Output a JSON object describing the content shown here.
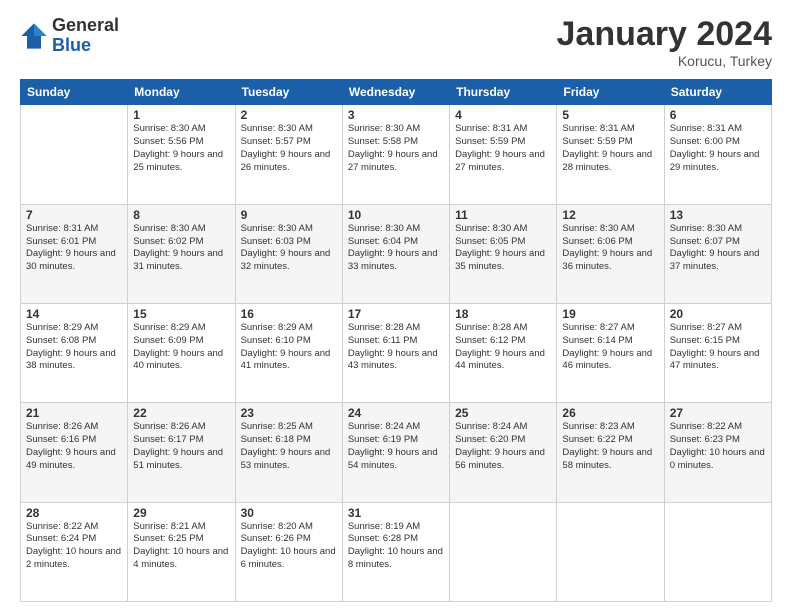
{
  "logo": {
    "general": "General",
    "blue": "Blue"
  },
  "title": {
    "month": "January 2024",
    "location": "Korucu, Turkey"
  },
  "weekdays": [
    "Sunday",
    "Monday",
    "Tuesday",
    "Wednesday",
    "Thursday",
    "Friday",
    "Saturday"
  ],
  "weeks": [
    [
      {
        "day": "",
        "empty": true
      },
      {
        "day": "1",
        "sunrise": "8:30 AM",
        "sunset": "5:56 PM",
        "daylight": "9 hours and 25 minutes."
      },
      {
        "day": "2",
        "sunrise": "8:30 AM",
        "sunset": "5:57 PM",
        "daylight": "9 hours and 26 minutes."
      },
      {
        "day": "3",
        "sunrise": "8:30 AM",
        "sunset": "5:58 PM",
        "daylight": "9 hours and 27 minutes."
      },
      {
        "day": "4",
        "sunrise": "8:31 AM",
        "sunset": "5:59 PM",
        "daylight": "9 hours and 27 minutes."
      },
      {
        "day": "5",
        "sunrise": "8:31 AM",
        "sunset": "5:59 PM",
        "daylight": "9 hours and 28 minutes."
      },
      {
        "day": "6",
        "sunrise": "8:31 AM",
        "sunset": "6:00 PM",
        "daylight": "9 hours and 29 minutes."
      }
    ],
    [
      {
        "day": "7",
        "sunrise": "8:31 AM",
        "sunset": "6:01 PM",
        "daylight": "9 hours and 30 minutes."
      },
      {
        "day": "8",
        "sunrise": "8:30 AM",
        "sunset": "6:02 PM",
        "daylight": "9 hours and 31 minutes."
      },
      {
        "day": "9",
        "sunrise": "8:30 AM",
        "sunset": "6:03 PM",
        "daylight": "9 hours and 32 minutes."
      },
      {
        "day": "10",
        "sunrise": "8:30 AM",
        "sunset": "6:04 PM",
        "daylight": "9 hours and 33 minutes."
      },
      {
        "day": "11",
        "sunrise": "8:30 AM",
        "sunset": "6:05 PM",
        "daylight": "9 hours and 35 minutes."
      },
      {
        "day": "12",
        "sunrise": "8:30 AM",
        "sunset": "6:06 PM",
        "daylight": "9 hours and 36 minutes."
      },
      {
        "day": "13",
        "sunrise": "8:30 AM",
        "sunset": "6:07 PM",
        "daylight": "9 hours and 37 minutes."
      }
    ],
    [
      {
        "day": "14",
        "sunrise": "8:29 AM",
        "sunset": "6:08 PM",
        "daylight": "9 hours and 38 minutes."
      },
      {
        "day": "15",
        "sunrise": "8:29 AM",
        "sunset": "6:09 PM",
        "daylight": "9 hours and 40 minutes."
      },
      {
        "day": "16",
        "sunrise": "8:29 AM",
        "sunset": "6:10 PM",
        "daylight": "9 hours and 41 minutes."
      },
      {
        "day": "17",
        "sunrise": "8:28 AM",
        "sunset": "6:11 PM",
        "daylight": "9 hours and 43 minutes."
      },
      {
        "day": "18",
        "sunrise": "8:28 AM",
        "sunset": "6:12 PM",
        "daylight": "9 hours and 44 minutes."
      },
      {
        "day": "19",
        "sunrise": "8:27 AM",
        "sunset": "6:14 PM",
        "daylight": "9 hours and 46 minutes."
      },
      {
        "day": "20",
        "sunrise": "8:27 AM",
        "sunset": "6:15 PM",
        "daylight": "9 hours and 47 minutes."
      }
    ],
    [
      {
        "day": "21",
        "sunrise": "8:26 AM",
        "sunset": "6:16 PM",
        "daylight": "9 hours and 49 minutes."
      },
      {
        "day": "22",
        "sunrise": "8:26 AM",
        "sunset": "6:17 PM",
        "daylight": "9 hours and 51 minutes."
      },
      {
        "day": "23",
        "sunrise": "8:25 AM",
        "sunset": "6:18 PM",
        "daylight": "9 hours and 53 minutes."
      },
      {
        "day": "24",
        "sunrise": "8:24 AM",
        "sunset": "6:19 PM",
        "daylight": "9 hours and 54 minutes."
      },
      {
        "day": "25",
        "sunrise": "8:24 AM",
        "sunset": "6:20 PM",
        "daylight": "9 hours and 56 minutes."
      },
      {
        "day": "26",
        "sunrise": "8:23 AM",
        "sunset": "6:22 PM",
        "daylight": "9 hours and 58 minutes."
      },
      {
        "day": "27",
        "sunrise": "8:22 AM",
        "sunset": "6:23 PM",
        "daylight": "10 hours and 0 minutes."
      }
    ],
    [
      {
        "day": "28",
        "sunrise": "8:22 AM",
        "sunset": "6:24 PM",
        "daylight": "10 hours and 2 minutes."
      },
      {
        "day": "29",
        "sunrise": "8:21 AM",
        "sunset": "6:25 PM",
        "daylight": "10 hours and 4 minutes."
      },
      {
        "day": "30",
        "sunrise": "8:20 AM",
        "sunset": "6:26 PM",
        "daylight": "10 hours and 6 minutes."
      },
      {
        "day": "31",
        "sunrise": "8:19 AM",
        "sunset": "6:28 PM",
        "daylight": "10 hours and 8 minutes."
      },
      {
        "day": "",
        "empty": true
      },
      {
        "day": "",
        "empty": true
      },
      {
        "day": "",
        "empty": true
      }
    ]
  ]
}
